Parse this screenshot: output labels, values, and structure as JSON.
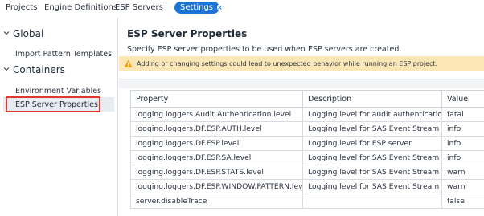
{
  "topnav": {
    "tabs": [
      {
        "label": "Projects"
      },
      {
        "label": "Engine Definitions"
      },
      {
        "label": "ESP Servers"
      }
    ],
    "active_tab": {
      "label": "Settings",
      "close_icon": "close-icon"
    }
  },
  "sidebar": {
    "groups": [
      {
        "title": "Global",
        "icon": "chevron-down-icon",
        "items": [
          {
            "label": "Import Pattern Templates"
          }
        ]
      },
      {
        "title": "Containers",
        "icon": "chevron-down-icon",
        "items": [
          {
            "label": "Environment Variables"
          },
          {
            "label": "ESP Server Properties",
            "selected": true
          }
        ]
      }
    ]
  },
  "main": {
    "title": "ESP Server Properties",
    "subtitle": "Specify ESP server properties to be used when ESP servers are created.",
    "warning": {
      "icon": "warning-icon",
      "color": "#fbe6b6",
      "text": "Adding or changing settings could lead to unexpected behavior while running an ESP project."
    },
    "table": {
      "headers": [
        "Property",
        "Description",
        "Value"
      ],
      "rows": [
        [
          "logging.loggers.Audit.Authentication.level",
          "Logging level for audit authentication",
          "fatal"
        ],
        [
          "logging.loggers.DF.ESP.AUTH.level",
          "Logging level for SAS Event Stream ...",
          "info"
        ],
        [
          "logging.loggers.DF.ESP.level",
          "Logging level for ESP server",
          "info"
        ],
        [
          "logging.loggers.DF.ESP.SA.level",
          "Logging level for SAS Event Stream ...",
          "info"
        ],
        [
          "logging.loggers.DF.ESP.STATS.level",
          "Logging level for SAS Event Stream ...",
          "warn"
        ],
        [
          "logging.loggers.DF.ESP.WINDOW.PATTERN.level",
          "Logging level for SAS Event Stream ...",
          "warn"
        ],
        [
          "server.disableTrace",
          "",
          "false"
        ]
      ]
    }
  },
  "colors": {
    "accent": "#1d74d6",
    "highlight_box": "#e0372f",
    "selected_bg": "#e6ecf2"
  }
}
